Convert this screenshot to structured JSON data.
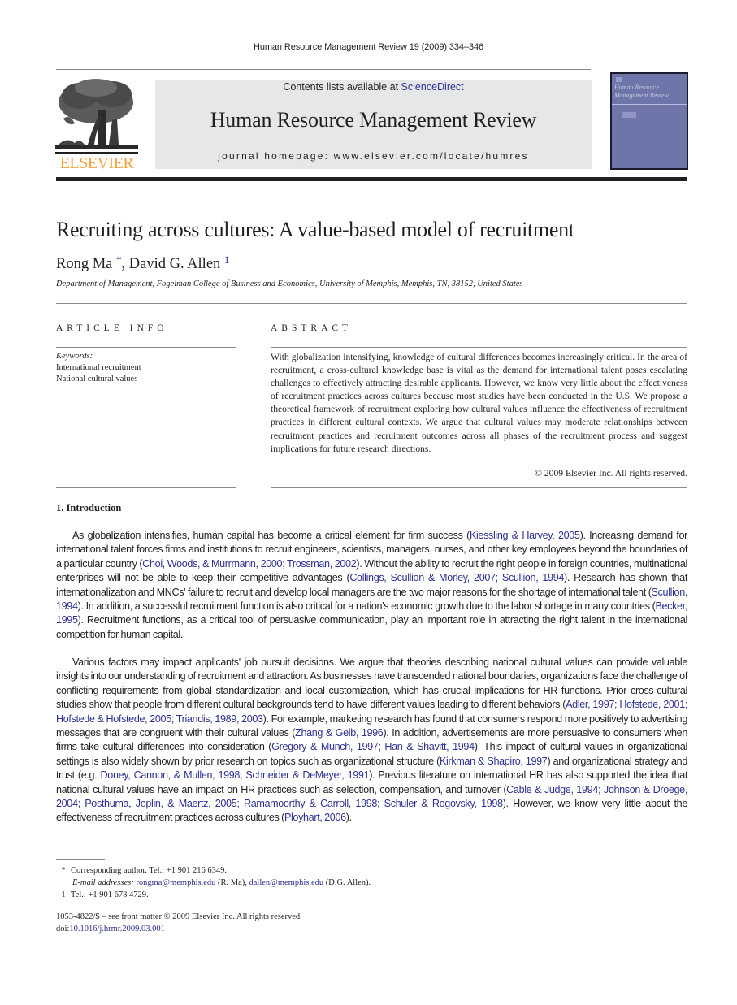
{
  "running_head": "Human Resource Management Review 19 (2009) 334–346",
  "publisher": {
    "logo_word": "ELSEVIER",
    "logo_color": "#f4a23b"
  },
  "banner": {
    "contents_prefix": "Contents lists available at ",
    "contents_link": "ScienceDirect",
    "journal_title": "Human Resource Management Review",
    "homepage_label": "journal homepage: www.elsevier.com/locate/humres"
  },
  "cover": {
    "title_line1": "Human Resource",
    "title_line2": "Management Review"
  },
  "article": {
    "title": "Recruiting across cultures: A value-based model of recruitment",
    "authors": [
      {
        "name": "Rong Ma",
        "mark": "*"
      },
      {
        "name": "David G. Allen",
        "mark": "1"
      }
    ],
    "author_separator": ", ",
    "affiliation": "Department of Management, Fogelman College of Business and Economics, University of Memphis, Memphis, TN, 38152, United States"
  },
  "article_info": {
    "heading": "ARTICLE INFO",
    "keywords_label": "Keywords:",
    "keywords": [
      "International recruitment",
      "National cultural values"
    ]
  },
  "abstract": {
    "heading": "ABSTRACT",
    "text": "With globalization intensifying, knowledge of cultural differences becomes increasingly critical. In the area of recruitment, a cross-cultural knowledge base is vital as the demand for international talent poses escalating challenges to effectively attracting desirable applicants. However, we know very little about the effectiveness of recruitment practices across cultures because most studies have been conducted in the U.S. We propose a theoretical framework of recruitment exploring how cultural values influence the effectiveness of recruitment practices in different cultural contexts. We argue that cultural values may moderate relationships between recruitment practices and recruitment outcomes across all phases of the recruitment process and suggest implications for future research directions.",
    "copyright": "© 2009 Elsevier Inc. All rights reserved."
  },
  "introduction": {
    "heading": "1. Introduction",
    "paragraphs": [
      [
        {
          "t": "As globalization intensifies, human capital has become a critical element for firm success ("
        },
        {
          "c": "Kiessling & Harvey, 2005"
        },
        {
          "t": "). Increasing demand for international talent forces firms and institutions to recruit engineers, scientists, managers, nurses, and other key employees beyond the boundaries of a particular country ("
        },
        {
          "c": "Choi, Woods, & Murrmann, 2000; Trossman, 2002"
        },
        {
          "t": "). Without the ability to recruit the right people in foreign countries, multinational enterprises will not be able to keep their competitive advantages ("
        },
        {
          "c": "Collings, Scullion & Morley, 2007; Scullion, 1994"
        },
        {
          "t": "). Research has shown that internationalization and MNCs' failure to recruit and develop local managers are the two major reasons for the shortage of international talent ("
        },
        {
          "c": "Scullion, 1994"
        },
        {
          "t": "). In addition, a successful recruitment function is also critical for a nation's economic growth due to the labor shortage in many countries ("
        },
        {
          "c": "Becker, 1995"
        },
        {
          "t": "). Recruitment functions, as a critical tool of persuasive communication, play an important role in attracting the right talent in the international competition for human capital."
        }
      ],
      [
        {
          "t": "Various factors may impact applicants' job pursuit decisions. We argue that theories describing national cultural values can provide valuable insights into our understanding of recruitment and attraction. As businesses have transcended national boundaries, organizations face the challenge of conflicting requirements from global standardization and local customization, which has crucial implications for HR functions. Prior cross-cultural studies show that people from different cultural backgrounds tend to have different values leading to different behaviors ("
        },
        {
          "c": "Adler, 1997; Hofstede, 2001; Hofstede & Hofstede, 2005; Triandis, 1989, 2003"
        },
        {
          "t": "). For example, marketing research has found that consumers respond more positively to advertising messages that are congruent with their cultural values ("
        },
        {
          "c": "Zhang & Gelb, 1996"
        },
        {
          "t": "). In addition, advertisements are more persuasive to consumers when firms take cultural differences into consideration ("
        },
        {
          "c": "Gregory & Munch, 1997; Han & Shavitt, 1994"
        },
        {
          "t": "). This impact of cultural values in organizational settings is also widely shown by prior research on topics such as organizational structure ("
        },
        {
          "c": "Kirkman & Shapiro, 1997"
        },
        {
          "t": ") and organizational strategy and trust (e.g. "
        },
        {
          "c": "Doney, Cannon, & Mullen, 1998; Schneider & DeMeyer, 1991"
        },
        {
          "t": "). Previous literature on international HR has also supported the idea that national cultural values have an impact on HR practices such as selection, compensation, and turnover ("
        },
        {
          "c": "Cable & Judge, 1994; Johnson & Droege, 2004; Posthuma, Joplin, & Maertz, 2005; Ramamoorthy & Carroll, 1998; Schuler & Rogovsky, 1998"
        },
        {
          "t": "). However, we know very little about the effectiveness of recruitment practices across cultures ("
        },
        {
          "c": "Ployhart, 2006"
        },
        {
          "t": ")."
        }
      ]
    ]
  },
  "footnotes": {
    "corresponding_mark": "*",
    "corresponding_text": "Corresponding author. Tel.: +1 901 216 6349.",
    "email_label": "E-mail addresses:",
    "email1": "rongma@memphis.edu",
    "email1_owner": " (R. Ma), ",
    "email2": "dallen@memphis.edu",
    "email2_owner": " (D.G. Allen).",
    "note1_mark": "1",
    "note1_text": "Tel.: +1 901 678 4729."
  },
  "front_matter": {
    "issn_line": "1053-4822/$ – see front matter © 2009 Elsevier Inc. All rights reserved.",
    "doi_label": "doi:",
    "doi": "10.1016/j.hrmr.2009.03.001"
  },
  "colors": {
    "link": "#2e3192",
    "banner_bg": "#e6e7e8",
    "cover_bg": "#6e75a8",
    "text": "#231f20"
  }
}
